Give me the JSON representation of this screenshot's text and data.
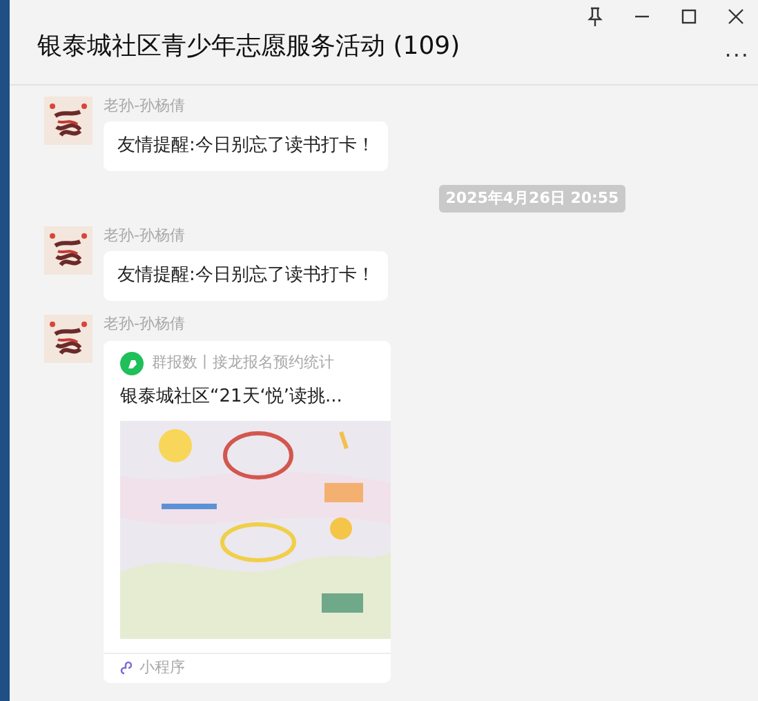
{
  "window": {
    "title": "银泰城社区青少年志愿服务活动 (109)",
    "more": "..."
  },
  "messages": [
    {
      "kind": "text",
      "sender": "老孙-孙杨倩",
      "text": "友情提醒:今日别忘了读书打卡！"
    },
    {
      "kind": "time",
      "text": "2025年4月26日 20:55"
    },
    {
      "kind": "text",
      "sender": "老孙-孙杨倩",
      "text": "友情提醒:今日别忘了读书打卡！"
    },
    {
      "kind": "card",
      "sender": "老孙-孙杨倩",
      "source": "群报数丨接龙报名预约统计",
      "title": "银泰城社区“21天‘悦’读挑...",
      "footer": "小程序"
    }
  ]
}
